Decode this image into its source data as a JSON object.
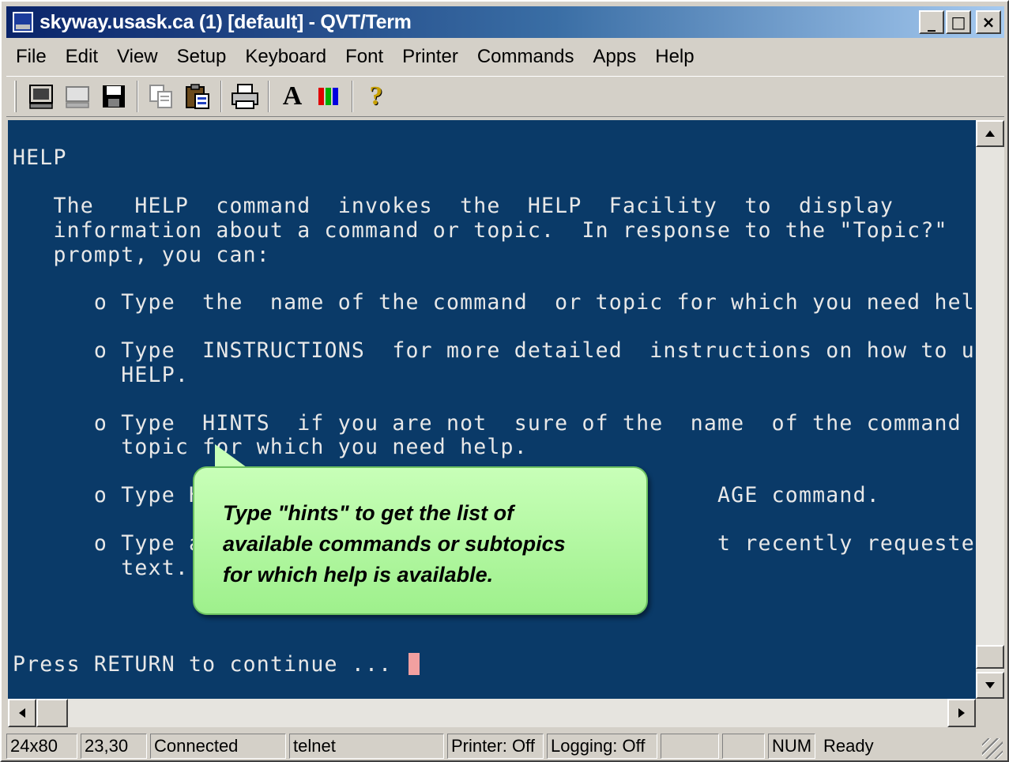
{
  "window": {
    "title": "skyway.usask.ca (1) [default] - QVT/Term",
    "minimize": "_",
    "maximize": "□",
    "close": "×"
  },
  "menu": [
    "File",
    "Edit",
    "View",
    "Setup",
    "Keyboard",
    "Font",
    "Printer",
    "Commands",
    "Apps",
    "Help"
  ],
  "toolbar": {
    "icons": [
      "terminal-icon",
      "disconnect-icon",
      "save-icon",
      "copy-icon",
      "paste-icon",
      "print-icon",
      "font-icon",
      "colors-icon",
      "help-icon"
    ],
    "font_glyph": "A",
    "help_glyph": "?"
  },
  "terminal": {
    "background": "#0a3a68",
    "lines": [
      "HELP",
      "   The   HELP  command  invokes  the  HELP  Facility  to  display",
      "   information about a command or topic.  In response to the \"Topic?\"",
      "   prompt, you can:",
      "      o Type  the  name of the command  or topic for which you need help.",
      "      o Type  INSTRUCTIONS  for more detailed  instructions on how to use",
      "        HELP.",
      "      o Type  HINTS  if you are not  sure of the  name  of the command or",
      "        topic for which you need help.",
      "      o Type HE",
      "                                                    AGE command.",
      "      o Type a",
      "                                                    t recently requested",
      "        text.",
      "Press RETURN to continue ... "
    ]
  },
  "callout": {
    "lines": [
      "Type \"hints\" to get the list of",
      "available commands or subtopics",
      "for which help is available."
    ],
    "color": "#a8f596"
  },
  "status": {
    "size": "24x80",
    "position": "23,30",
    "connection": "Connected",
    "protocol": "telnet",
    "printer": "Printer: Off",
    "logging": "Logging: Off",
    "num": "NUM",
    "state": "Ready"
  }
}
